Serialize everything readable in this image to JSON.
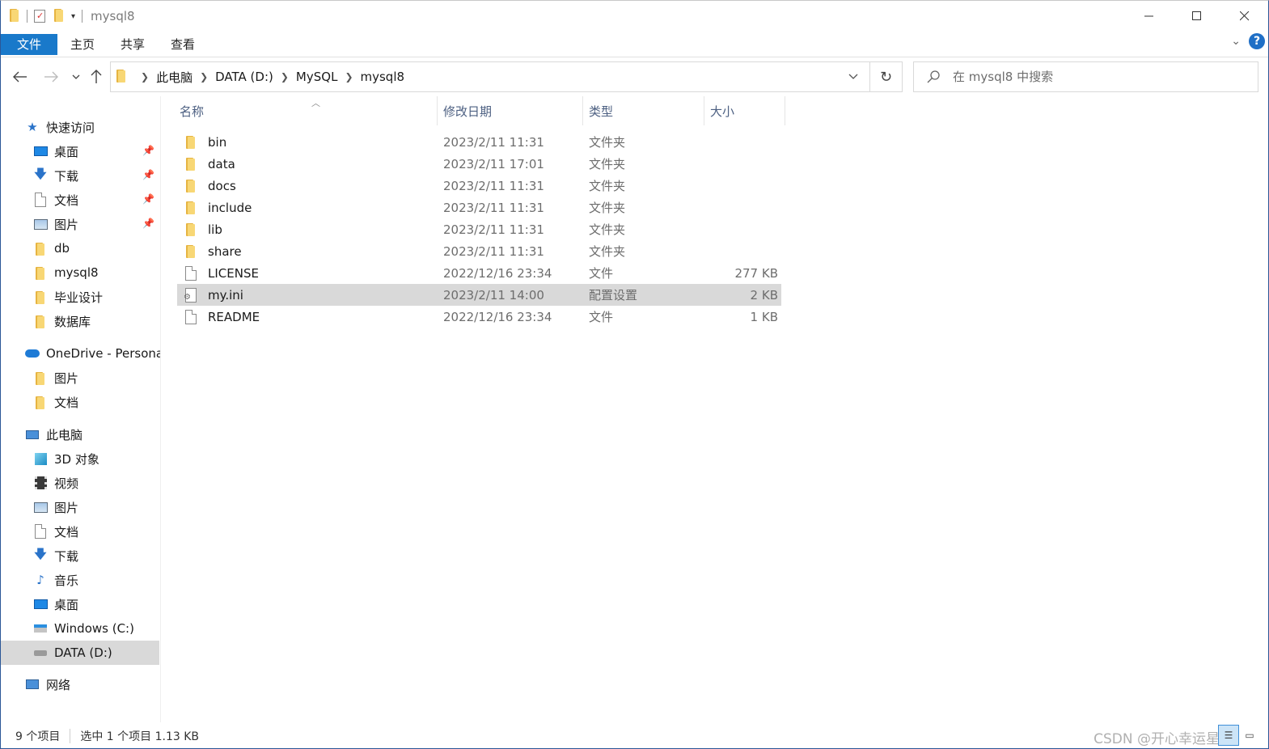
{
  "window": {
    "title": "mysql8"
  },
  "ribbon": {
    "tabs": [
      "文件",
      "主页",
      "共享",
      "查看"
    ]
  },
  "address": {
    "crumbs": [
      "此电脑",
      "DATA (D:)",
      "MySQL",
      "mysql8"
    ]
  },
  "search": {
    "placeholder": "在 mysql8 中搜索"
  },
  "nav": {
    "quick_access": "快速访问",
    "quick_items": [
      "桌面",
      "下载",
      "文档",
      "图片",
      "db",
      "mysql8",
      "毕业设计",
      "数据库"
    ],
    "onedrive": "OneDrive - Persona",
    "onedrive_items": [
      "图片",
      "文档"
    ],
    "this_pc": "此电脑",
    "pc_items": [
      "3D 对象",
      "视频",
      "图片",
      "文档",
      "下载",
      "音乐",
      "桌面",
      "Windows (C:)",
      "DATA (D:)"
    ],
    "network": "网络"
  },
  "columns": {
    "name": "名称",
    "date": "修改日期",
    "type": "类型",
    "size": "大小"
  },
  "files": [
    {
      "name": "bin",
      "date": "2023/2/11 11:31",
      "type": "文件夹",
      "size": "",
      "kind": "folder"
    },
    {
      "name": "data",
      "date": "2023/2/11 17:01",
      "type": "文件夹",
      "size": "",
      "kind": "folder"
    },
    {
      "name": "docs",
      "date": "2023/2/11 11:31",
      "type": "文件夹",
      "size": "",
      "kind": "folder"
    },
    {
      "name": "include",
      "date": "2023/2/11 11:31",
      "type": "文件夹",
      "size": "",
      "kind": "folder"
    },
    {
      "name": "lib",
      "date": "2023/2/11 11:31",
      "type": "文件夹",
      "size": "",
      "kind": "folder"
    },
    {
      "name": "share",
      "date": "2023/2/11 11:31",
      "type": "文件夹",
      "size": "",
      "kind": "folder"
    },
    {
      "name": "LICENSE",
      "date": "2022/12/16 23:34",
      "type": "文件",
      "size": "277 KB",
      "kind": "file"
    },
    {
      "name": "my.ini",
      "date": "2023/2/11 14:00",
      "type": "配置设置",
      "size": "2 KB",
      "kind": "ini",
      "selected": true
    },
    {
      "name": "README",
      "date": "2022/12/16 23:34",
      "type": "文件",
      "size": "1 KB",
      "kind": "file"
    }
  ],
  "status": {
    "count": "9 个项目",
    "selection": "选中 1 个项目 1.13 KB",
    "watermark": "CSDN @开心幸运星"
  },
  "colors": {
    "accent": "#1979ca",
    "selection": "#d9d9d9",
    "folder": "#f8d775"
  }
}
